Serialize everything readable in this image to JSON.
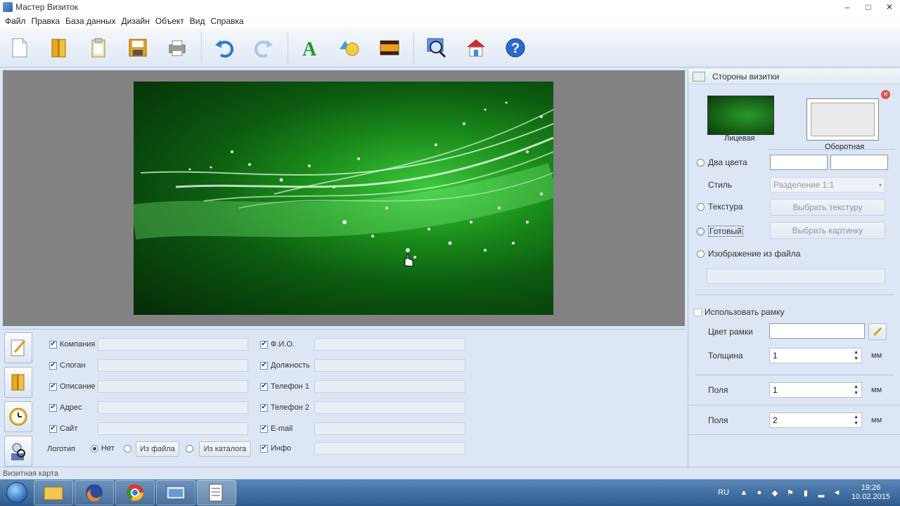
{
  "window": {
    "title": "Мастер Визиток",
    "minimize": "–",
    "maximize": "□",
    "close": "✕"
  },
  "menu": [
    "Файл",
    "Правка",
    "База данных",
    "Дизайн",
    "Объект",
    "Вид",
    "Справка"
  ],
  "toolbar_icons": [
    "new-file-icon",
    "open-folder-icon",
    "clipboard-icon",
    "save-icon",
    "print-icon",
    "undo-icon",
    "redo-icon",
    "text-icon",
    "shapes-icon",
    "image-icon",
    "zoom-icon",
    "home-icon",
    "help-icon"
  ],
  "bottom": {
    "left_fields": [
      {
        "label": "Компания",
        "checked": true,
        "value": ""
      },
      {
        "label": "Слоган",
        "checked": true,
        "value": ""
      },
      {
        "label": "Описание",
        "checked": true,
        "value": ""
      },
      {
        "label": "Адрес",
        "checked": true,
        "value": ""
      },
      {
        "label": "Сайт",
        "checked": true,
        "value": ""
      }
    ],
    "right_fields": [
      {
        "label": "Ф.И.О.",
        "checked": true,
        "value": ""
      },
      {
        "label": "Должность",
        "checked": true,
        "value": ""
      },
      {
        "label": "Телефон 1",
        "checked": true,
        "value": ""
      },
      {
        "label": "Телефон 2",
        "checked": true,
        "value": ""
      },
      {
        "label": "E-mail",
        "checked": true,
        "value": ""
      },
      {
        "label": "Инфо",
        "checked": true,
        "value": ""
      }
    ],
    "logo": {
      "label": "Логотип",
      "none": "Нет",
      "from_file": "Из файла",
      "from_catalog": "Из каталога"
    }
  },
  "right_panel": {
    "header": "Стороны визитки",
    "front_label": "Лицевая",
    "back_label": "Оборотная",
    "two_colors": "Два цвета",
    "style_label": "Стиль",
    "style_value": "Разделение 1:1",
    "texture": "Текстура",
    "choose_texture": "Выбрать текстуру",
    "ready": "Готовый",
    "choose_picture": "Выбрать картинку",
    "image_from_file": "Изображение из файла",
    "use_frame": "Использовать рамку",
    "frame_color": "Цвет рамки",
    "thickness": "Толщина",
    "thickness_value": "1",
    "unit_mm": "мм",
    "margins": "Поля",
    "margins_value_1": "1",
    "margins_value_2": "2"
  },
  "status": "Визитная карта",
  "tray": {
    "lang": "RU",
    "time": "19:26",
    "date": "10.02.2015"
  },
  "colors": {
    "toolbar_bg": "#e6edf6",
    "panel_bg": "#dce6f4",
    "canvas_bg": "#828282",
    "taskbar": "#3a6698"
  }
}
